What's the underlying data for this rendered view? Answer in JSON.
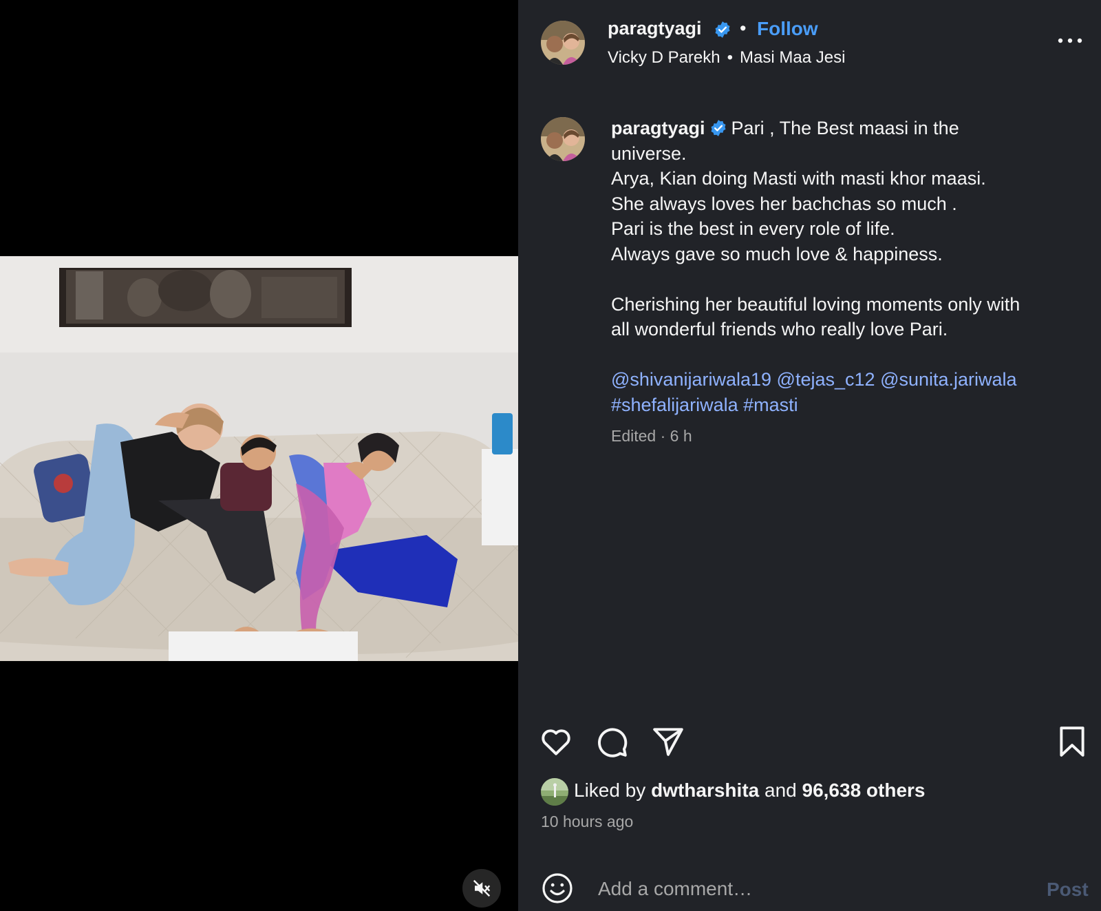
{
  "post": {
    "username": "paragtyagi",
    "follow_label": "Follow",
    "header_dot": "•",
    "music_artist": "Vicky D Parekh",
    "music_sep": "•",
    "music_title": "Masi Maa Jesi",
    "more_label": "•••"
  },
  "caption": {
    "username": "paragtyagi",
    "first_line": "Pari , The Best maasi in the",
    "lines": [
      "universe.",
      "Arya, Kian doing Masti with masti khor maasi.",
      "She always loves her bachchas so much .",
      "Pari is the best in every role of life.",
      "Always gave so much love & happiness."
    ],
    "paragraph2": [
      "Cherishing her beautiful loving moments only with",
      "all wonderful friends who really love Pari."
    ],
    "tags_line1": [
      "@shivanijariwala19",
      "@tejas_c12",
      "@sunita.jariwala"
    ],
    "tags_line2": [
      "#shefalijariwala",
      "#masti"
    ],
    "edited_label": "Edited",
    "meta_sep": "·",
    "posted_time": "6 h"
  },
  "likes": {
    "prefix": "Liked by",
    "liker": "dwtharshita",
    "joiner": "and",
    "others": "96,638 others",
    "time_ago": "10 hours ago"
  },
  "comment": {
    "placeholder": "Add a comment…",
    "post_label": "Post"
  },
  "icons": {
    "mute": "speaker-muted-icon",
    "like": "heart-icon",
    "comment": "comment-bubble-icon",
    "share": "paper-plane-icon",
    "save": "bookmark-icon",
    "emoji": "smiley-icon",
    "more": "more-dots-icon",
    "verified": "verified-badge-icon"
  },
  "colors": {
    "panel_bg": "#212328",
    "link": "#8fb2ff",
    "follow": "#4a9df8",
    "verified": "#3897f0",
    "muted_text": "#a8a8a8",
    "post_disabled": "#4b5a75"
  }
}
